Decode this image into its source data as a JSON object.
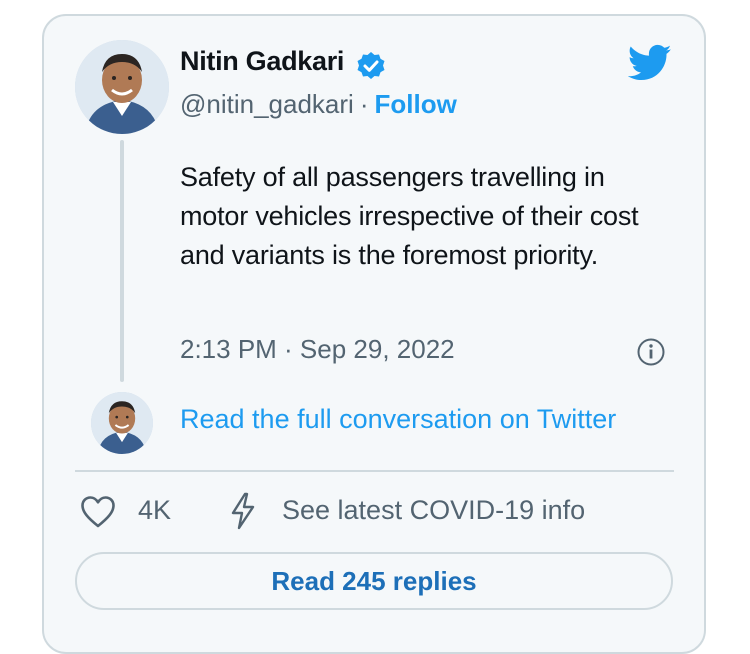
{
  "tweet": {
    "author_name": "Nitin Gadkari",
    "handle": "@nitin_gadkari",
    "separator": "·",
    "follow_label": "Follow",
    "text": "Safety of all passengers travelling in motor vehicles irrespective of their cost and variants is the foremost priority.",
    "timestamp": "2:13 PM · Sep 29, 2022",
    "read_conversation_label": "Read the full conversation on Twitter",
    "likes_count": "4K",
    "covid_info_label": "See latest COVID-19 info",
    "replies_label": "Read 245 replies"
  },
  "icons": {
    "verified": "verified-badge-icon",
    "logo": "twitter-bird-icon",
    "info": "info-icon",
    "like": "heart-icon",
    "covid": "lightning-bolt-icon"
  },
  "colors": {
    "card_background": "#f5f8fa",
    "border": "#cfd9de",
    "twitter_blue": "#1d9bf0",
    "secondary_text": "#536471",
    "primary_text": "#0f1419"
  }
}
